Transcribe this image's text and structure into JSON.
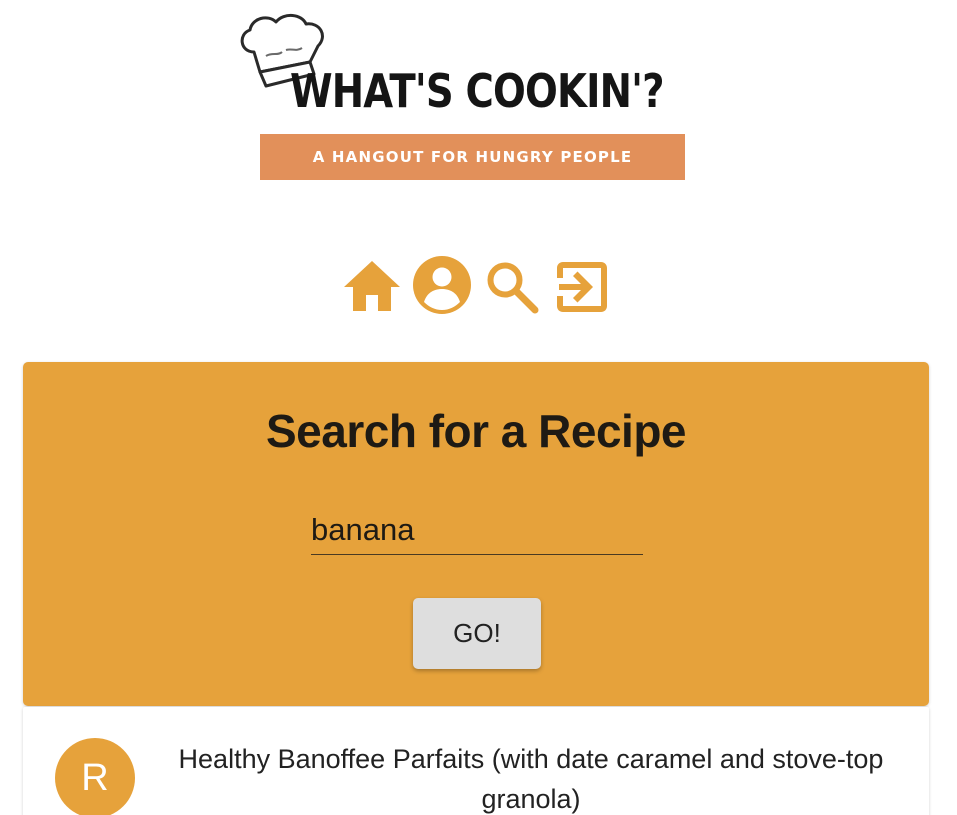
{
  "header": {
    "logo_title": "WHAT'S COOKIN'?",
    "logo_tagline": "A HANGOUT FOR HUNGRY PEOPLE"
  },
  "nav": {
    "items": [
      {
        "name": "home",
        "icon": "home-icon"
      },
      {
        "name": "profile",
        "icon": "account-circle-icon"
      },
      {
        "name": "search",
        "icon": "search-icon"
      },
      {
        "name": "logout",
        "icon": "exit-icon"
      }
    ]
  },
  "search": {
    "title": "Search for a Recipe",
    "value": "banana",
    "button_label": "GO!"
  },
  "results": [
    {
      "avatar_letter": "R",
      "title": "Healthy Banoffee Parfaits (with date caramel and stove-top granola)"
    }
  ],
  "colors": {
    "accent": "#e6a23b",
    "tagline_bg": "#e2905a",
    "button_bg": "#dedede"
  }
}
